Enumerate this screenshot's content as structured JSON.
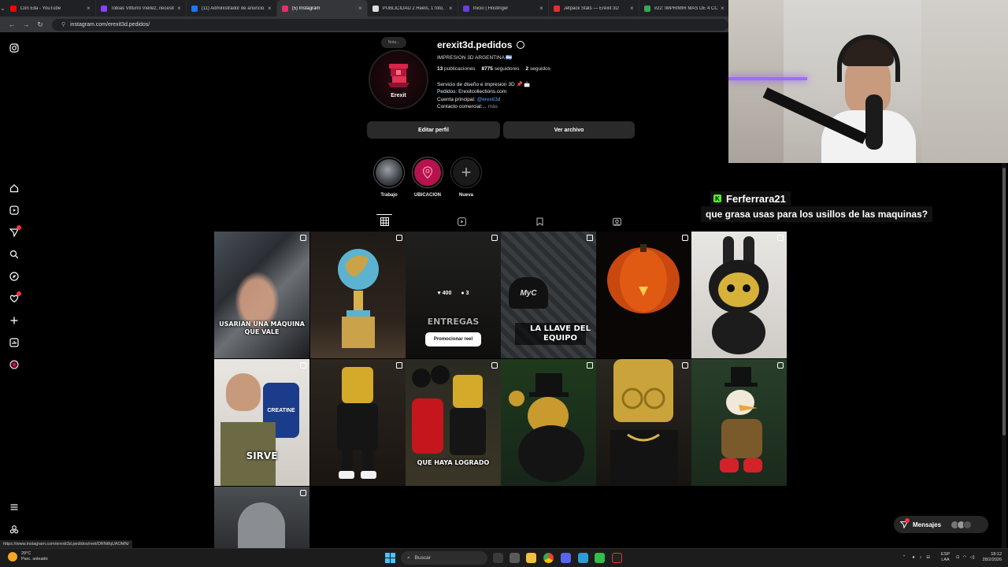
{
  "browser": {
    "tabs": [
      {
        "title": "Con Ella - YouTube",
        "color": "#ff0000"
      },
      {
        "title": "Tobias Vitturro Vieitez, necesit...",
        "color": "#8a3ffc"
      },
      {
        "title": "(11) Administrador de anuncio...",
        "color": "#1877f2"
      },
      {
        "title": "(5) Instagram",
        "color": "#e1306c"
      },
      {
        "title": "PUBLICIDAD 2 Reels, 1 foto, 1...",
        "color": "#dddddd"
      },
      {
        "title": "Inicio | Hostinger",
        "color": "#673de6"
      },
      {
        "title": "Jetpack Stats — Erexit 3D",
        "color": "#e03030"
      },
      {
        "title": "#22: IMPRIMIR MAS DE 4 CO...",
        "color": "#34a853"
      }
    ],
    "url": "instagram.com/erexit3d.pedidos/",
    "status_url": "https://www.instagram.com/erexit3d.pedidos/reel/DRNtfqUAOMN/"
  },
  "profile": {
    "note": "Nota...",
    "avatar_brand": "Erexit",
    "username": "erexit3d.pedidos",
    "tagline": "IMPRESION 3D ARGENTINA 🇦🇷",
    "posts_count": "13",
    "posts_label": "publicaciones",
    "followers_count": "8775",
    "followers_label": "seguidores",
    "following_count": "2",
    "following_label": "seguidos",
    "bio_line1": "Servicio de diseño e impresion 3D 📌 📩",
    "bio_line2": "Pedidos: Erexitcollections.com",
    "bio_line3_prefix": "Cuenta principal:",
    "bio_line3_mention": "@erexit3d",
    "bio_line4": "Contacto comercial:...",
    "bio_more": "más",
    "edit_button": "Editar perfil",
    "archive_button": "Ver archivo"
  },
  "highlights": [
    {
      "label": "Trabajo"
    },
    {
      "label": "UBICACION"
    },
    {
      "label": "Nueva"
    }
  ],
  "grid": {
    "posts": [
      {
        "caption": "USARIAN UNA MÁQUINA QUE VALE",
        "reel": true
      },
      {
        "caption": "",
        "reel": true
      },
      {
        "caption": "ENTREGAS",
        "reel": true,
        "likes": "400",
        "comments": "3",
        "promote": "Promocionar reel"
      },
      {
        "caption": "LA LLAVE DEL EQUIPO",
        "reel": false,
        "extra": "MyC"
      },
      {
        "caption": "",
        "reel": true
      },
      {
        "caption": "",
        "reel": true
      },
      {
        "caption": "SIRVE",
        "reel": true,
        "extra": "CREATINE"
      },
      {
        "caption": "",
        "reel": false
      },
      {
        "caption": "QUE HAYA LOGRADO",
        "reel": true
      },
      {
        "caption": "",
        "reel": false
      },
      {
        "caption": "",
        "reel": true
      },
      {
        "caption": "",
        "reel": true
      },
      {
        "caption": "",
        "reel": true
      }
    ]
  },
  "chat": {
    "username": "Ferferrara21",
    "message": "que grasa usas para los usillos de las maquinas?"
  },
  "messages_button": "Mensajes",
  "taskbar": {
    "temp": "29°C",
    "weather": "Parc. soleado",
    "search": "Buscar",
    "lang1": "ESP",
    "lang2": "LAA",
    "time": "18:12",
    "date": "28/2/2026"
  }
}
